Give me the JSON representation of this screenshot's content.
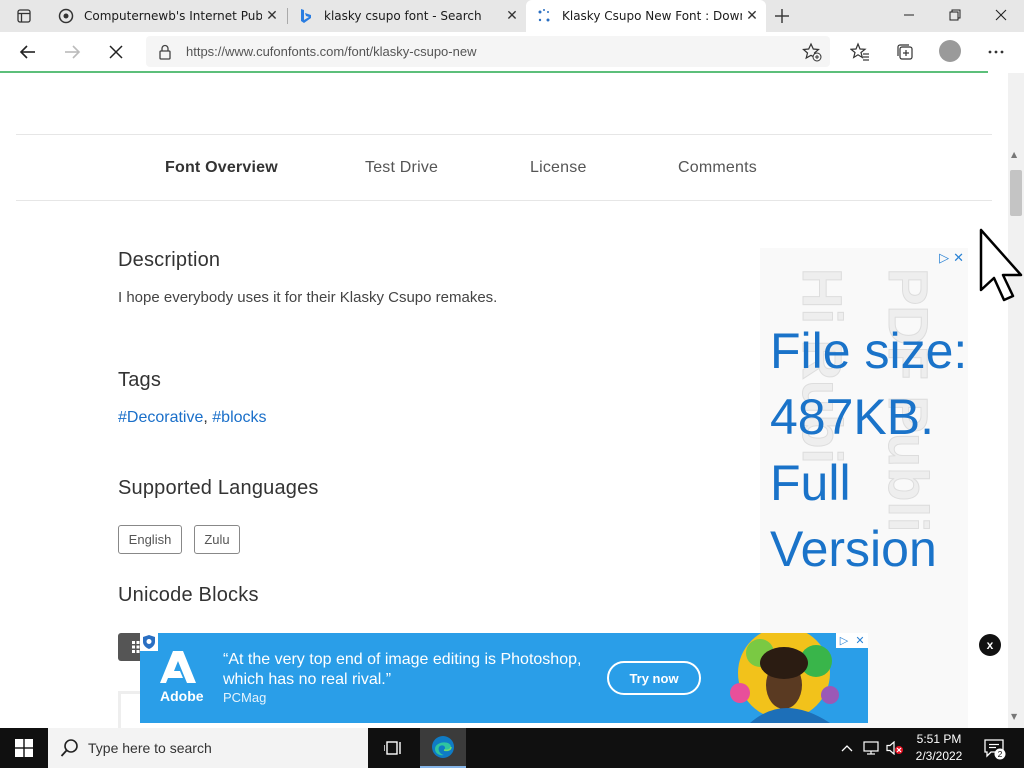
{
  "browser": {
    "tabs": [
      {
        "title": "Computernewb's Internet Pub H",
        "active": false
      },
      {
        "title": "klasky csupo font - Search",
        "active": false
      },
      {
        "title": "Klasky Csupo New Font : Downlo",
        "active": true
      }
    ],
    "url": "https://www.cufonfonts.com/font/klasky-csupo-new"
  },
  "subnav": {
    "items": [
      {
        "label": "Font Overview",
        "active": true
      },
      {
        "label": "Test Drive",
        "active": false
      },
      {
        "label": "License",
        "active": false
      },
      {
        "label": "Comments",
        "active": false
      }
    ]
  },
  "description": {
    "title": "Description",
    "text": "I hope everybody uses it for their Klasky Csupo remakes."
  },
  "tags": {
    "title": "Tags",
    "items": [
      "#Decorative",
      "#blocks"
    ],
    "separator": ","
  },
  "languages": {
    "title": "Supported Languages",
    "items": [
      "English",
      "Zulu"
    ]
  },
  "unicode": {
    "title": "Unicode Blocks"
  },
  "side_ad": {
    "text": "File size: 487KB. Full Version",
    "watermark_1": "Hi Rubi",
    "watermark_2": "PDF Publi",
    "close_label": "x",
    "accent": "#1a73c9"
  },
  "banner_ad": {
    "brand": "Adobe",
    "quote": "“At the very top end of image editing is Photoshop, which has no real rival.”",
    "source": "PCMag",
    "cta": "Try now",
    "background": "#2a9ee8"
  },
  "taskbar": {
    "search_placeholder": "Type here to search",
    "time": "5:51 PM",
    "date": "2/3/2022",
    "notification_count": "2"
  },
  "colors": {
    "link": "#1a6fc9",
    "load_progress": "#5cbf7a"
  }
}
